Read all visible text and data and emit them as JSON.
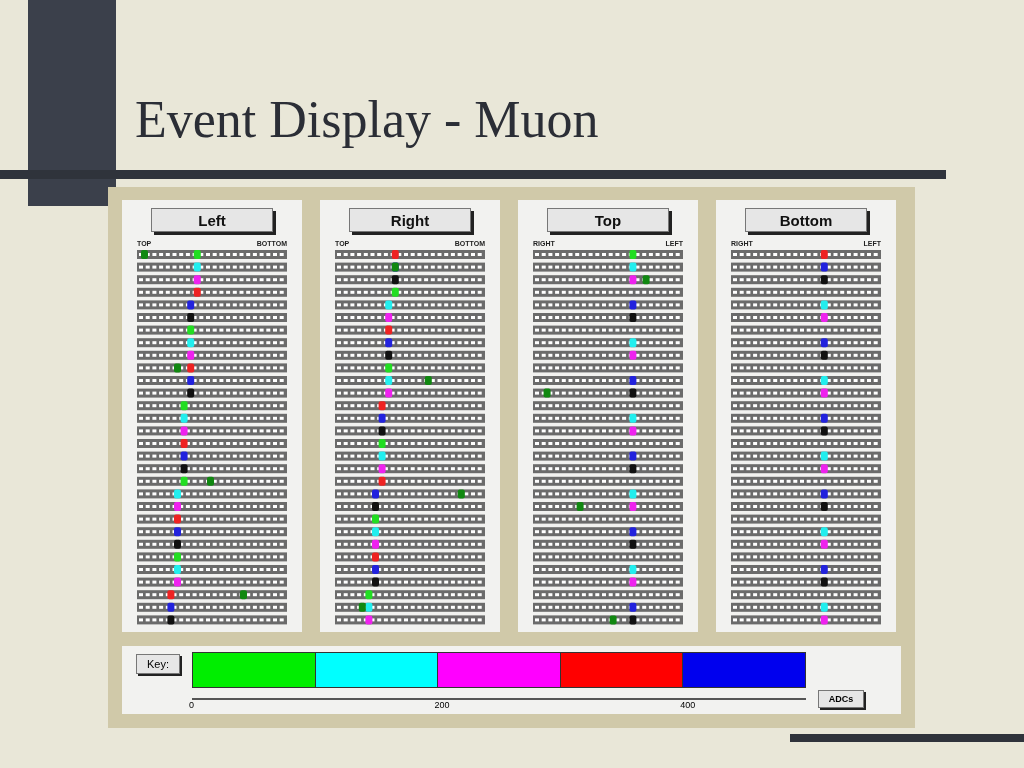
{
  "slide": {
    "title": "Event Display - Muon"
  },
  "panels": [
    {
      "label": "Left",
      "axis_start": "TOP",
      "axis_end": "BOTTOM"
    },
    {
      "label": "Right",
      "axis_start": "TOP",
      "axis_end": "BOTTOM"
    },
    {
      "label": "Top",
      "axis_start": "RIGHT",
      "axis_end": "LEFT"
    },
    {
      "label": "Bottom",
      "axis_start": "RIGHT",
      "axis_end": "LEFT"
    }
  ],
  "key": {
    "label": "Key:",
    "unit_button": "ADCs",
    "segments": [
      {
        "color": "#00ee00"
      },
      {
        "color": "#00ffff"
      },
      {
        "color": "#ff00ff"
      },
      {
        "color": "#ff0000"
      },
      {
        "color": "#0000ee"
      }
    ],
    "ticks": [
      "0",
      "200",
      "400"
    ]
  }
}
